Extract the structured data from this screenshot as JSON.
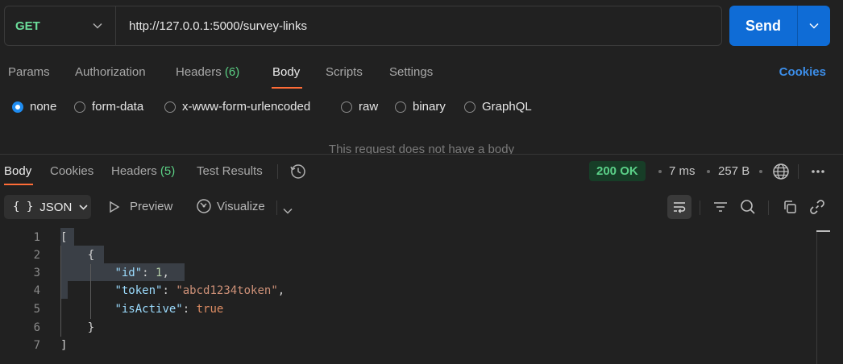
{
  "request": {
    "method": "GET",
    "url": "http://127.0.0.1:5000/survey-links",
    "send_label": "Send"
  },
  "req_tabs": {
    "params": "Params",
    "authorization": "Authorization",
    "headers": "Headers",
    "headers_count": "(6)",
    "body": "Body",
    "scripts": "Scripts",
    "settings": "Settings",
    "cookies": "Cookies"
  },
  "body_types": [
    "none",
    "form-data",
    "x-www-form-urlencoded",
    "raw",
    "binary",
    "GraphQL"
  ],
  "body_selected": "none",
  "no_body_message": "This request does not have a body",
  "response": {
    "tabs": {
      "body": "Body",
      "cookies": "Cookies",
      "headers": "Headers",
      "headers_count": "(5)",
      "test_results": "Test Results"
    },
    "status": "200 OK",
    "time": "7 ms",
    "size": "257 B",
    "format": "JSON",
    "preview": "Preview",
    "visualize": "Visualize"
  },
  "code": {
    "line_numbers": [
      "1",
      "2",
      "3",
      "4",
      "5",
      "6",
      "7"
    ],
    "open_bracket": "[",
    "open_brace": "{",
    "id_key": "\"id\"",
    "id_value": "1",
    "token_key": "\"token\"",
    "token_value": "\"abcd1234token\"",
    "active_key": "\"isActive\"",
    "active_value": "true",
    "close_brace": "}",
    "close_bracket": "]"
  },
  "colors": {
    "accent": "#ff6c37",
    "send": "#0f6cd6",
    "method": "#6bdd9a",
    "status_bg": "#173d27",
    "status_fg": "#5bd088",
    "link": "#3c8ee9"
  }
}
